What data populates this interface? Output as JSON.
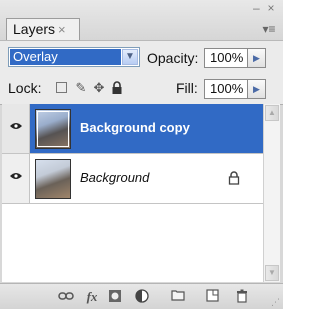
{
  "panel": {
    "tab_label": "Layers",
    "tab_close": "×",
    "window_close": "×",
    "window_minimize": "–",
    "menu_glyph": "▾≡"
  },
  "blend": {
    "mode": "Overlay",
    "opacity_label": "Opacity:",
    "opacity_value": "100%",
    "lock_label": "Lock:",
    "fill_label": "Fill:",
    "fill_value": "100%"
  },
  "layers": [
    {
      "name": "Background copy",
      "selected": true,
      "visible": true,
      "locked": false
    },
    {
      "name": "Background",
      "selected": false,
      "visible": true,
      "locked": true
    }
  ],
  "footer": {
    "icons": [
      "link-layers-icon",
      "fx-icon",
      "add-mask-icon",
      "adjustment-layer-icon",
      "new-group-icon",
      "new-layer-icon",
      "delete-icon"
    ],
    "fx_label": "fx"
  },
  "colors": {
    "selection": "#316ac5",
    "panel_bg": "#d8d8d8"
  }
}
